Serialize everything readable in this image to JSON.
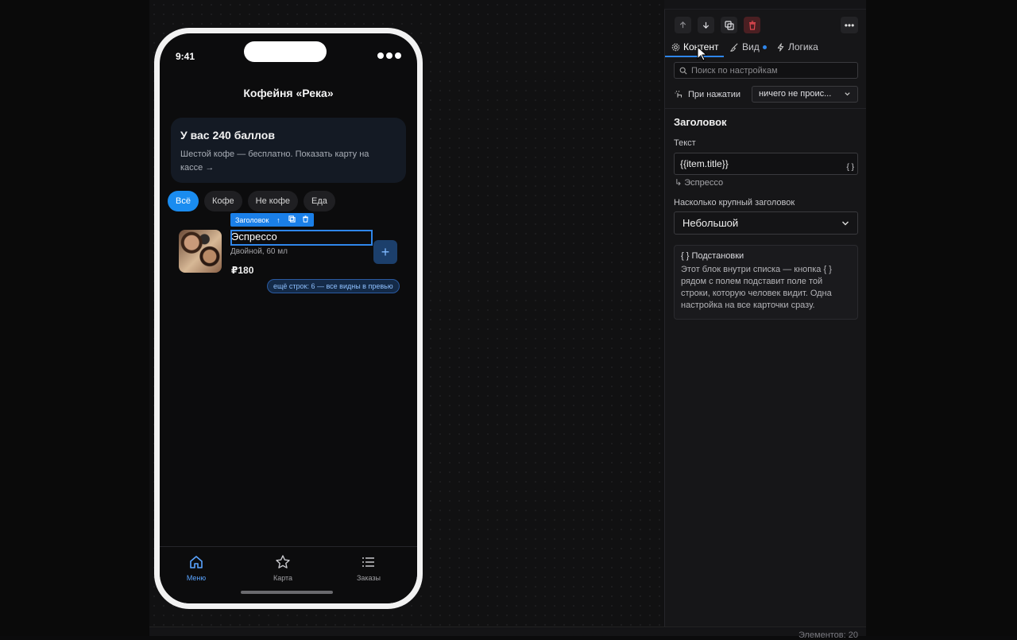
{
  "statusbar": {
    "elements_count": "Элементов: 20"
  },
  "phone": {
    "time": "9:41",
    "app_title": "Кофейня «Река»",
    "points_card": {
      "title": "У вас 240 баллов",
      "subtitle": "Шестой кофе — бесплатно. Показать карту на кассе →"
    },
    "chips": [
      {
        "label": "Всё",
        "active": true
      },
      {
        "label": "Кофе",
        "active": false
      },
      {
        "label": "Не кофе",
        "active": false
      },
      {
        "label": "Еда",
        "active": false
      }
    ],
    "item": {
      "title": "Эспрессо",
      "subtitle": "Двойной, 60 мл",
      "price": "₽180",
      "add_icon": "plus-icon"
    },
    "selection_toolbar": {
      "label": "Заголовок"
    },
    "more_rows": "ещё строк: 6 — все видны в превью",
    "tabbar": [
      {
        "label": "Меню",
        "icon": "home-icon",
        "active": true
      },
      {
        "label": "Карта",
        "icon": "star-icon",
        "active": false
      },
      {
        "label": "Заказы",
        "icon": "list-icon",
        "active": false
      }
    ]
  },
  "panel": {
    "tabs": [
      {
        "label": "Контент",
        "icon": "gear-icon",
        "active": true
      },
      {
        "label": "Вид",
        "icon": "brush-icon",
        "active": false,
        "dot": true
      },
      {
        "label": "Логика",
        "icon": "bolt-icon",
        "active": false
      }
    ],
    "search_placeholder": "Поиск по настройкам",
    "on_press": {
      "label": "При нажатии",
      "value": "ничего не проис..."
    },
    "section_title": "Заголовок",
    "text_field": {
      "label": "Текст",
      "value": "{{item.title}}",
      "bind_button": "{ }",
      "preview": "↳ Эспрессо"
    },
    "size_field": {
      "label": "Насколько крупный заголовок",
      "value": "Небольшой"
    },
    "hint": {
      "title": "{ } Подстановки",
      "body": "Этот блок внутри списка — кнопка { } рядом с полем подставит поле той строки, которую человек видит. Одна настройка на все карточки сразу."
    }
  },
  "colors": {
    "accent": "#2f86ea",
    "danger": "#e0474f",
    "chip_active": "#1a8cf0"
  }
}
